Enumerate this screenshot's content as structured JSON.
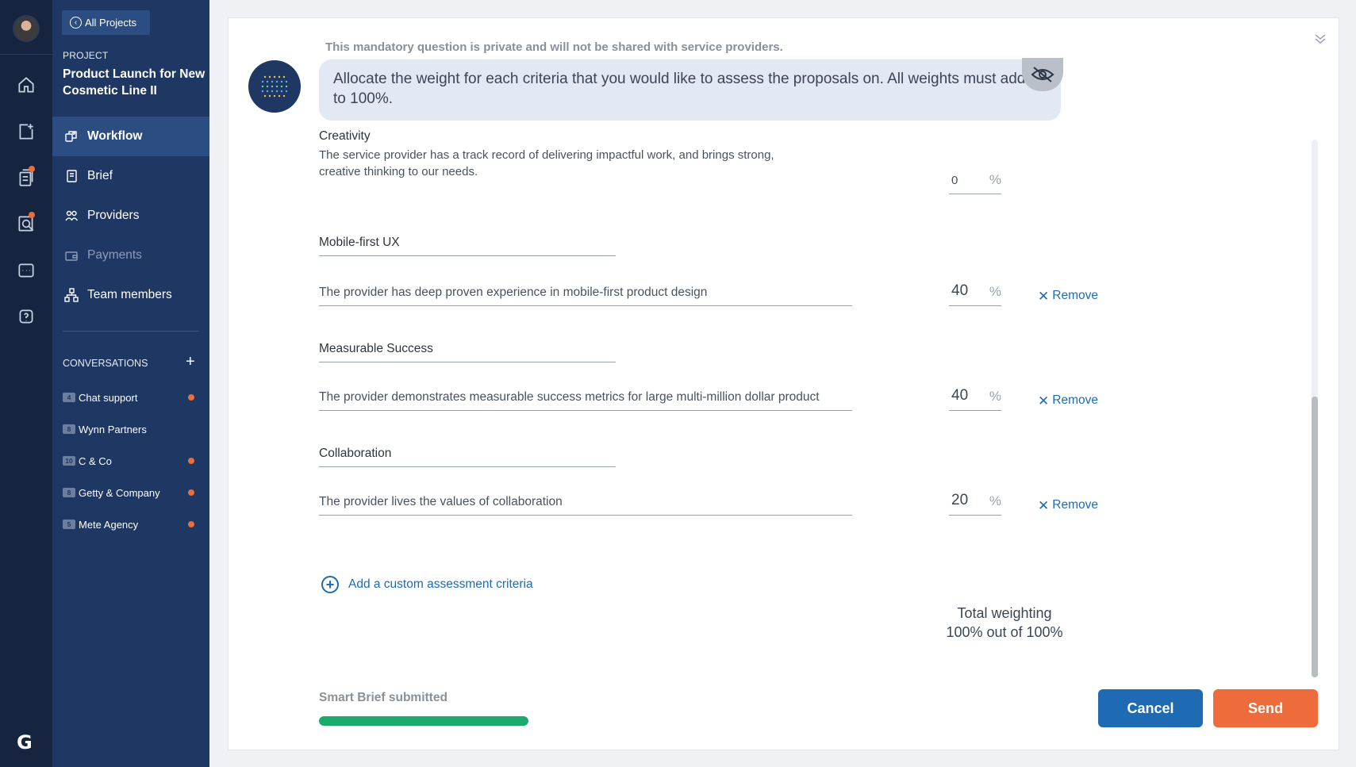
{
  "sidebar": {
    "back_label": "All Projects",
    "project_label": "PROJECT",
    "project_title": "Product Launch for New Cosmetic Line II",
    "nav": [
      {
        "label": "Workflow",
        "icon": "workflow-icon",
        "state": "active"
      },
      {
        "label": "Brief",
        "icon": "brief-icon",
        "state": "normal"
      },
      {
        "label": "Providers",
        "icon": "providers-icon",
        "state": "normal"
      },
      {
        "label": "Payments",
        "icon": "payments-icon",
        "state": "disabled"
      },
      {
        "label": "Team members",
        "icon": "team-icon",
        "state": "normal"
      }
    ],
    "conversations_header": "CONVERSATIONS",
    "conversations_add": "+",
    "conversations": [
      {
        "count": "4",
        "name": "Chat support",
        "unread": true
      },
      {
        "count": "8",
        "name": "Wynn Partners",
        "unread": false
      },
      {
        "count": "10",
        "name": "C & Co",
        "unread": true
      },
      {
        "count": "8",
        "name": "Getty & Company",
        "unread": true
      },
      {
        "count": "5",
        "name": "Mete Agency",
        "unread": true
      }
    ]
  },
  "rail": {
    "icons": [
      "home-icon",
      "new-project-icon",
      "documents-icon",
      "search-providers-icon",
      "messages-icon",
      "help-icon"
    ],
    "logo": "G"
  },
  "question": {
    "private_note": "This mandatory question is private and will not be shared with service providers.",
    "text": "Allocate the weight for each criteria that you would like to assess the proposals on. All weights must add up to 100%."
  },
  "criteria": [
    {
      "title": "Creativity",
      "description": "The service provider has a track record of delivering impactful work, and brings strong, creative thinking to our needs.",
      "value": "0",
      "unit": "%",
      "removable": false
    },
    {
      "title": "Mobile-first UX",
      "description": "The provider has deep proven experience in mobile-first product design",
      "value": "40",
      "unit": "%",
      "removable": true
    },
    {
      "title": "Measurable Success",
      "description": "The provider demonstrates measurable success metrics for large multi-million dollar product",
      "value": "40",
      "unit": "%",
      "removable": true
    },
    {
      "title": "Collaboration",
      "description": "The provider lives the values of collaboration",
      "value": "20",
      "unit": "%",
      "removable": true
    }
  ],
  "remove_label": "Remove",
  "add_criteria_label": "Add a custom assessment criteria",
  "total": {
    "label": "Total weighting",
    "value": "100% out of 100%"
  },
  "footer": {
    "status": "Smart Brief submitted",
    "progress": 1.0,
    "cancel": "Cancel",
    "send": "Send"
  },
  "colors": {
    "sidebar": "#1e3763",
    "rail": "#162440",
    "accent_blue": "#1f6bb3",
    "accent_orange": "#ee6b3b",
    "progress": "#1aaa6b"
  }
}
